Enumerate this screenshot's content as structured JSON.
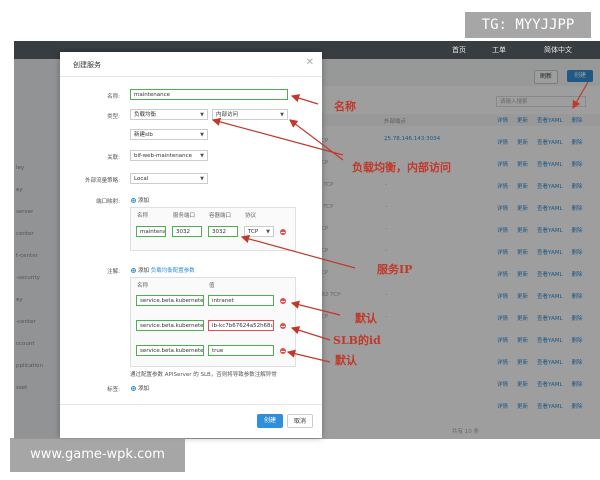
{
  "watermarks": {
    "top_right": "TG: MYYJJPP",
    "bottom_left": "www.game-wpk.com"
  },
  "background": {
    "topbar_links": [
      "首页",
      "工单",
      "简体中文"
    ],
    "btn_refresh": "刷新",
    "btn_create": "创建",
    "search_placeholder": "请输入搜索",
    "col_header": "外部端点",
    "row_ip": "25.78.146.143:3034",
    "row_actions": [
      "详情",
      "更新",
      "查看YAML",
      "删除"
    ],
    "row_tcps": [
      "TCP",
      "TCP",
      "2 TCP",
      "2 TCP",
      "TCP",
      "TCP",
      "TCP",
      "092 TCP",
      "TCP"
    ],
    "side_labels": [
      "ley",
      "ey",
      "server",
      "center",
      "t-center",
      "-security",
      "ey",
      "-center",
      "ccount",
      "pplication",
      "sset"
    ],
    "footer_text": "共有 10 条"
  },
  "dialog": {
    "title": "创建服务",
    "labels": {
      "name": "名称:",
      "type": "类型:",
      "related": "关联:",
      "traffic": "外部流量策略:",
      "port_mapping": "端口映射:",
      "annotations": "注解:",
      "tags": "标签:"
    },
    "name_value": "maintenance",
    "type_select": "负载均衡",
    "access_select": "内部访问",
    "slb_select": "新建slb",
    "related_select": "bif-web-maintenance",
    "traffic_select": "Local",
    "add_label": "添加",
    "port_headers": [
      "名称",
      "服务端口",
      "容器端口",
      "协议"
    ],
    "port_row": {
      "name": "maintenar",
      "service_port": "3032",
      "container_port": "3032",
      "protocol": "TCP"
    },
    "annot_link": "负载均衡配置参数",
    "annot_headers": [
      "名称",
      "值"
    ],
    "annotations": [
      {
        "name": "service.beta.kubernetes.ic",
        "value": "intranet"
      },
      {
        "name": "service.beta.kubernetes.ic",
        "value": "lb-kc7b67624a52h68ufvzy"
      },
      {
        "name": "service.beta.kubernetes.ic",
        "value": "true"
      }
    ],
    "annot_note": "通过配置参数 APIServer 的 SLB，否则将导致参数注解异常",
    "ok": "创建",
    "cancel": "取消"
  },
  "annotation_texts": {
    "name": "名称",
    "lb": "负载均衡，内部访问",
    "service_ip": "服务IP",
    "default1": "默认",
    "slb_id": "SLB的id",
    "default2": "默认"
  },
  "colors": {
    "accent": "#2f8fd8",
    "annotation": "#c0392b",
    "highlight_green": "#4caf50",
    "danger": "#e05050"
  }
}
